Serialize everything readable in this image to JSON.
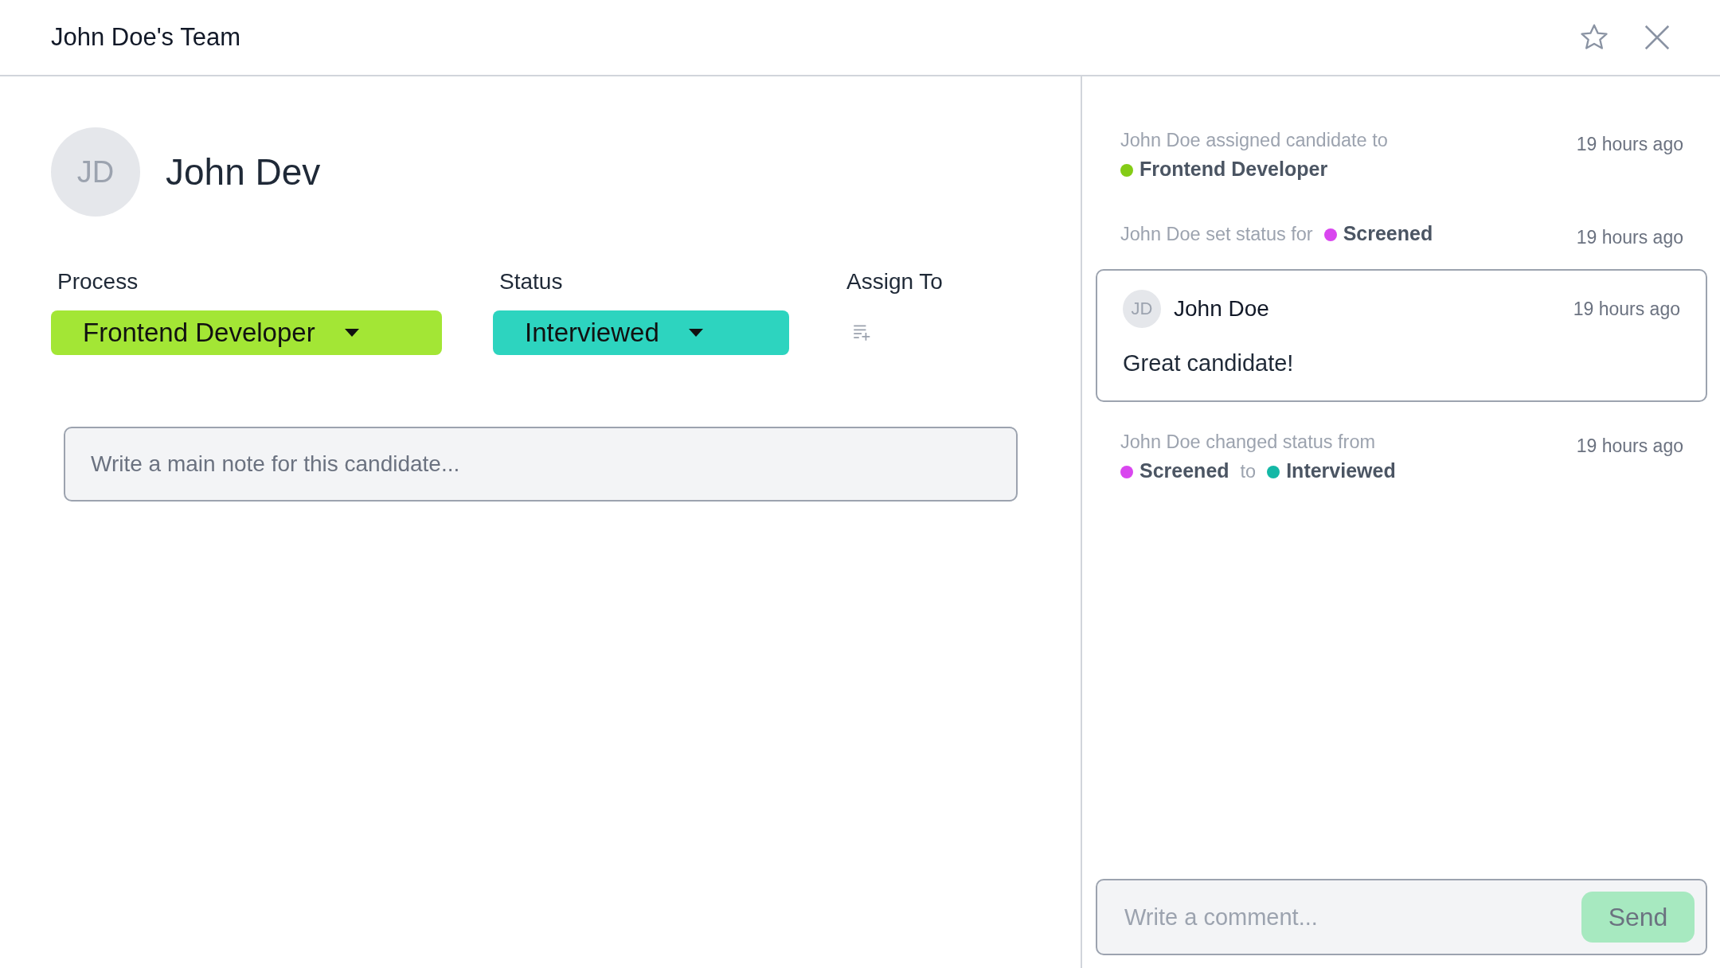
{
  "window": {
    "title": "John Doe's Team"
  },
  "candidate": {
    "initials": "JD",
    "name": "John Dev"
  },
  "fields": [
    {
      "kind": "dropdown",
      "label": "Process",
      "value": "Frontend Developer",
      "color": "#a3e635"
    },
    {
      "kind": "dropdown",
      "label": "Status",
      "value": "Interviewed",
      "color": "#2dd4bf"
    },
    {
      "kind": "assign",
      "label": "Assign To"
    }
  ],
  "note": {
    "placeholder": "Write a main note for this candidate..."
  },
  "activity": [
    {
      "kind": "event",
      "time": "19 hours ago",
      "parts": [
        {
          "kind": "text",
          "text": "John Doe assigned candidate to"
        },
        {
          "kind": "tag",
          "label": "Frontend Developer",
          "color": "#84cc16"
        }
      ]
    },
    {
      "kind": "event",
      "time": "19 hours ago",
      "parts": [
        {
          "kind": "text",
          "text": "John Doe set status for"
        },
        {
          "kind": "tag",
          "label": "Screened",
          "color": "#d946ef"
        }
      ]
    },
    {
      "kind": "comment",
      "initials": "JD",
      "author": "John Doe",
      "time": "19 hours ago",
      "text": "Great candidate!"
    },
    {
      "kind": "event",
      "time": "19 hours ago",
      "parts": [
        {
          "kind": "text",
          "text": "John Doe changed status from"
        },
        {
          "kind": "tag",
          "label": "Screened",
          "color": "#d946ef"
        },
        {
          "kind": "text",
          "text": "to"
        },
        {
          "kind": "tag",
          "label": "Interviewed",
          "color": "#14b8a6"
        }
      ]
    }
  ],
  "comment_box": {
    "placeholder": "Write a comment...",
    "button": "Send"
  }
}
